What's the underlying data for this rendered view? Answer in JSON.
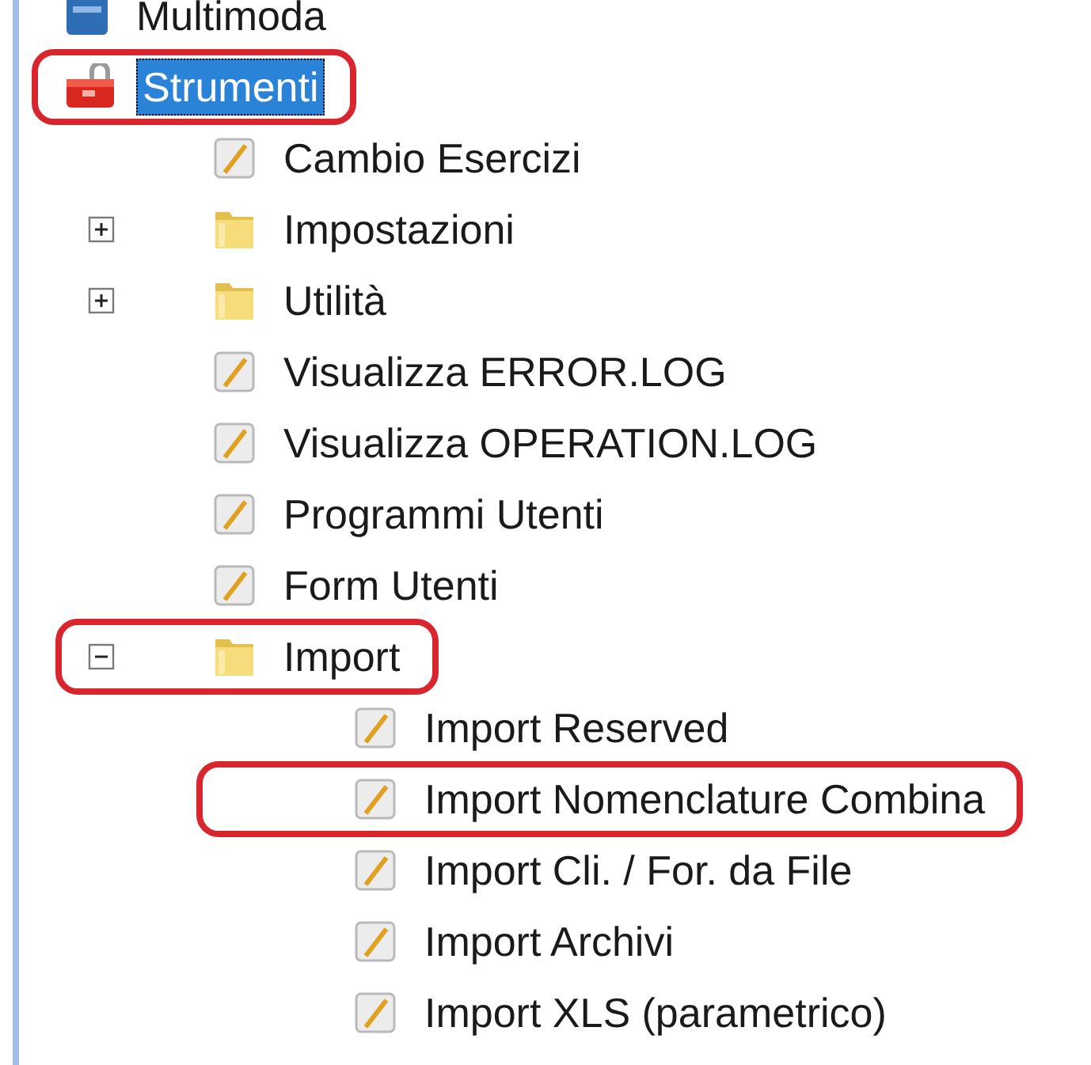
{
  "tree": [
    {
      "label": "Multimoda",
      "kind": "module",
      "selected": false,
      "highlighted": false
    },
    {
      "label": "Strumenti",
      "kind": "toolbox",
      "selected": true,
      "highlighted": true,
      "children": [
        {
          "label": "Cambio Esercizi",
          "kind": "program",
          "selected": false,
          "highlighted": false
        },
        {
          "label": "Impostazioni",
          "kind": "folder",
          "expanded": false,
          "selected": false,
          "highlighted": false
        },
        {
          "label": "Utilità",
          "kind": "folder",
          "expanded": false,
          "selected": false,
          "highlighted": false
        },
        {
          "label": "Visualizza ERROR.LOG",
          "kind": "program",
          "selected": false,
          "highlighted": false
        },
        {
          "label": "Visualizza OPERATION.LOG",
          "kind": "program",
          "selected": false,
          "highlighted": false
        },
        {
          "label": "Programmi Utenti",
          "kind": "program",
          "selected": false,
          "highlighted": false
        },
        {
          "label": "Form Utenti",
          "kind": "program",
          "selected": false,
          "highlighted": false
        },
        {
          "label": "Import",
          "kind": "folder",
          "expanded": true,
          "selected": false,
          "highlighted": true,
          "children": [
            {
              "label": "Import Reserved",
              "kind": "program",
              "selected": false,
              "highlighted": false
            },
            {
              "label": "Import Nomenclature Combina",
              "kind": "program",
              "selected": false,
              "highlighted": true
            },
            {
              "label": "Import Cli. / For. da File",
              "kind": "program",
              "selected": false,
              "highlighted": false
            },
            {
              "label": "Import Archivi",
              "kind": "program",
              "selected": false,
              "highlighted": false
            },
            {
              "label": "Import XLS (parametrico)",
              "kind": "program",
              "selected": false,
              "highlighted": false
            }
          ]
        }
      ]
    }
  ]
}
